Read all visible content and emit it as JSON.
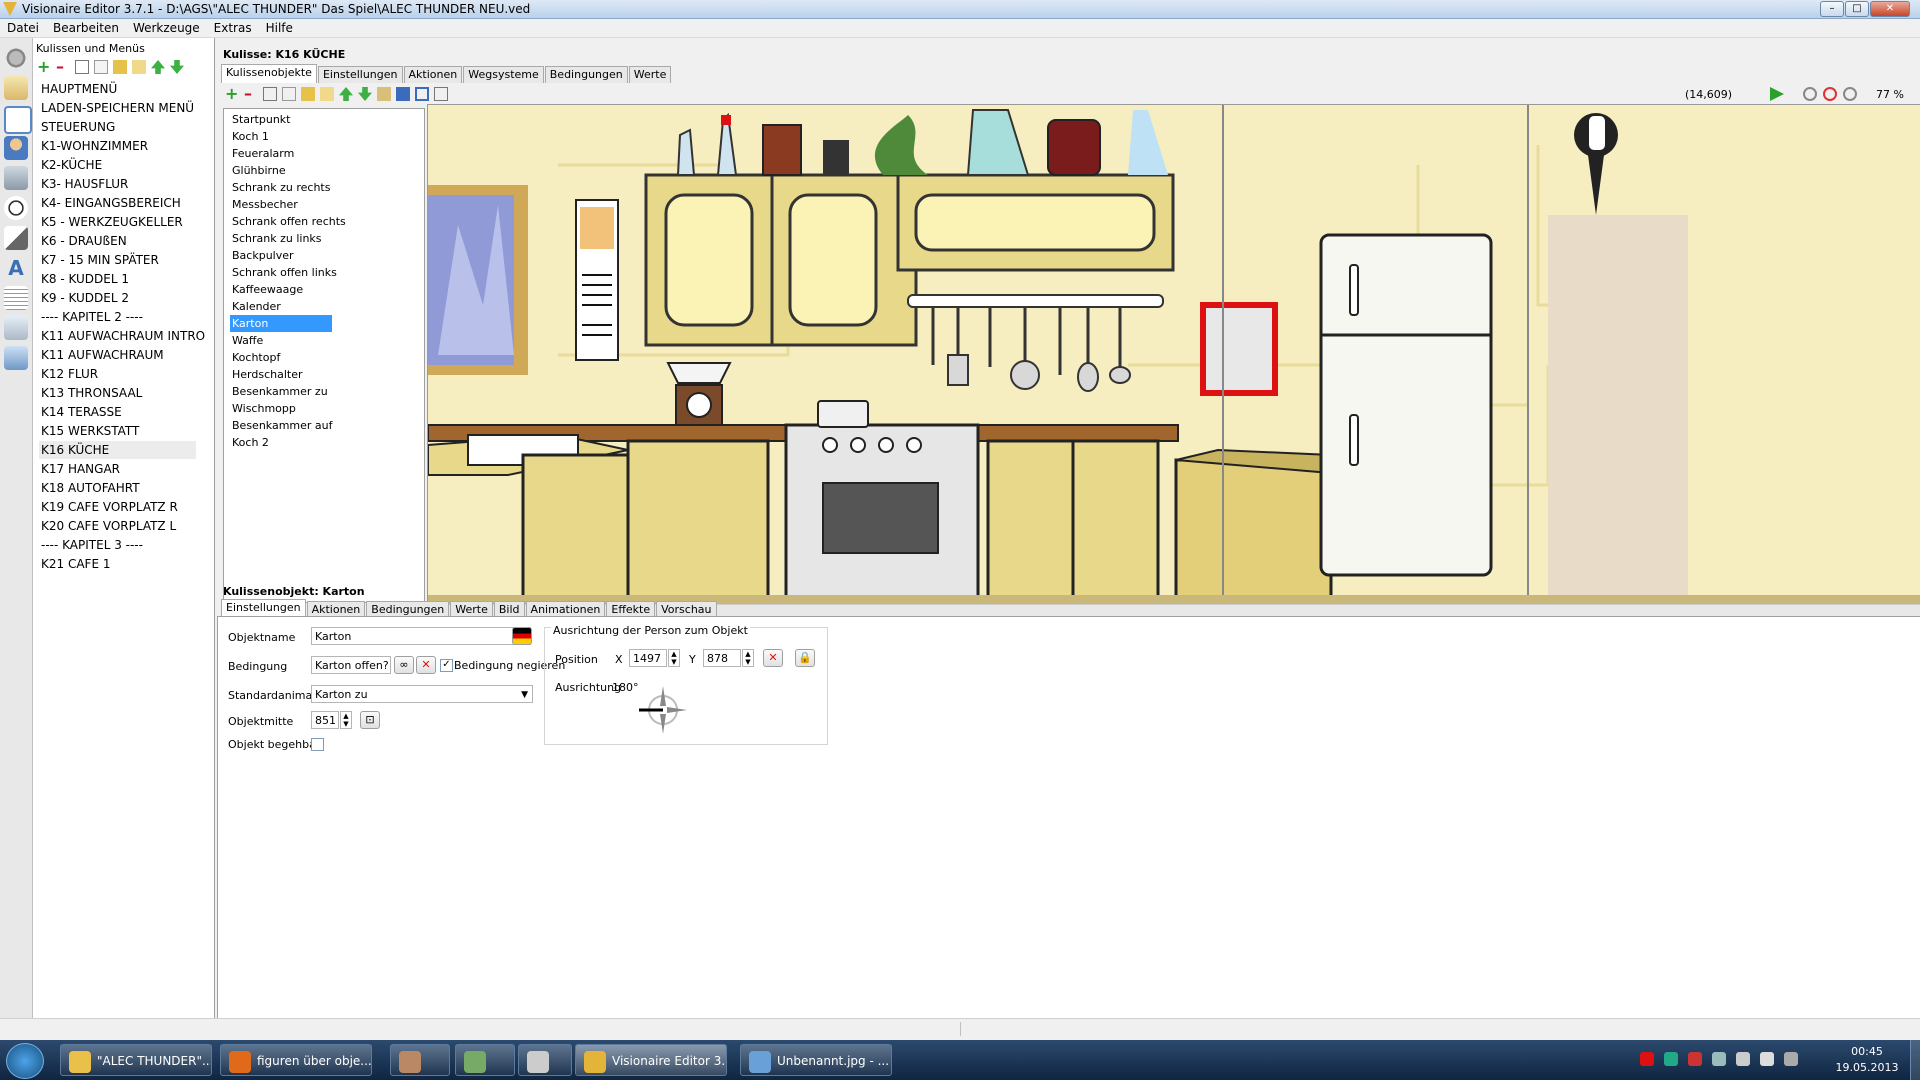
{
  "window": {
    "title": "Visionaire Editor 3.7.1 - D:\\AGS\\\"ALEC THUNDER\" Das Spiel\\ALEC THUNDER NEU.ved",
    "controls": {
      "minimize": "–",
      "maximize": "□",
      "close": "✕"
    }
  },
  "menu": [
    "Datei",
    "Bearbeiten",
    "Werkzeuge",
    "Extras",
    "Hilfe"
  ],
  "scenes_panel": {
    "header": "Kulissen und Menüs",
    "items": [
      "HAUPTMENÜ",
      "LADEN-SPEICHERN MENÜ",
      "STEUERUNG",
      "K1-WOHNZIMMER",
      "K2-KÜCHE",
      "K3- HAUSFLUR",
      "K4- EINGANGSBEREICH",
      "K5 - WERKZEUGKELLER",
      "K6 - DRAUßEN",
      "K7 - 15 MIN SPÄTER",
      "K8 - KUDDEL 1",
      "K9 - KUDDEL 2",
      "---- KAPITEL 2 ----",
      "K11 AUFWACHRAUM INTRO",
      "K11 AUFWACHRAUM",
      "K12 FLUR",
      "K13 THRONSAAL",
      "K14 TERASSE",
      "K15 WERKSTATT",
      "K16 KÜCHE",
      "K17 HANGAR",
      "K18 AUTOFAHRT",
      "K19 CAFE VORPLATZ R",
      "K20 CAFE VORPLATZ L",
      "---- KAPITEL 3 ----",
      "K21 CAFE 1"
    ],
    "selected_index": 19
  },
  "scene": {
    "header": "Kulisse: K16 KÜCHE",
    "tabs": [
      "Kulissenobjekte",
      "Einstellungen",
      "Aktionen",
      "Wegsysteme",
      "Bedingungen",
      "Werte"
    ],
    "active_tab": 0,
    "objects": [
      "Startpunkt",
      "Koch 1",
      "Feueralarm",
      "Glühbirne",
      "Schrank zu rechts",
      "Messbecher",
      "Schrank offen rechts",
      "Schrank zu links",
      "Backpulver",
      "Schrank offen links",
      "Kaffeewaage",
      "Kalender",
      "Karton",
      "Waffe",
      "Kochtopf",
      "Herdschalter",
      "Besenkammer zu",
      "Wischmopp",
      "Besenkammer auf",
      "Koch 2"
    ],
    "selected_object_index": 12,
    "coords": "(14,609)",
    "zoom": "77 %"
  },
  "object_panel": {
    "header": "Kulissenobjekt: Karton",
    "tabs": [
      "Einstellungen",
      "Aktionen",
      "Bedingungen",
      "Werte",
      "Bild",
      "Animationen",
      "Effekte",
      "Vorschau"
    ],
    "active_tab": 0,
    "fields": {
      "objektname_label": "Objektname",
      "objektname_value": "Karton",
      "bedingung_label": "Bedingung",
      "bedingung_value": "Karton offen?",
      "negate_label": "Bedingung negieren",
      "standardanimation_label": "Standardanimation",
      "standardanimation_value": "Karton zu",
      "objektmitte_label": "Objektmitte",
      "objektmitte_value": "851",
      "begehbar_label": "Objekt begehbar"
    },
    "negate_checked": true,
    "begehbar_checked": false,
    "alignment": {
      "title": "Ausrichtung der Person zum Objekt",
      "position_label": "Position",
      "x_label": "X",
      "x_value": "1497",
      "y_label": "Y",
      "y_value": "878",
      "direction_label": "Ausrichtung",
      "direction_value": "180°"
    }
  },
  "taskbar": {
    "buttons": [
      "\"ALEC THUNDER\"...",
      "figuren über obje...",
      "",
      "",
      "",
      "Visionaire Editor 3...",
      "Unbenannt.jpg - ..."
    ],
    "active_index": 5,
    "clock_time": "00:45",
    "clock_date": "19.05.2013"
  },
  "colors": {
    "selection": "#3399ff",
    "taskbar": "#1b3656",
    "canvas_wall": "#f6eec0",
    "cabinet": "#e8d98a",
    "counter": "#a0662e"
  }
}
